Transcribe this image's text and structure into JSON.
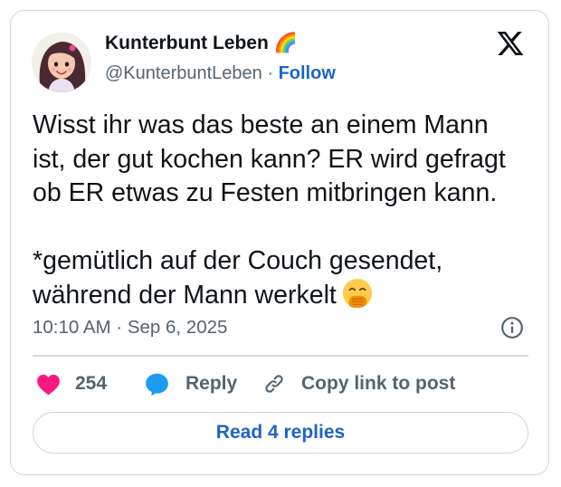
{
  "author": {
    "display_name": "Kunterbunt Leben 🌈",
    "handle": "@KunterbuntLeben",
    "separator": " · ",
    "follow_label": "Follow"
  },
  "tweet": {
    "paragraph_1": [
      "Wisst ihr was das beste an einem Mann",
      "ist, der gut kochen kann? ER wird gefragt",
      "ob ER etwas zu Festen mitbringen kann."
    ],
    "paragraph_2": [
      "*gemütlich auf der Couch gesendet,",
      "während der Mann werkelt"
    ],
    "emoji": "face-with-hand-over-mouth"
  },
  "timestamp": "10:10 AM · Sep 6, 2025",
  "actions": {
    "like_count": "254",
    "reply_label": "Reply",
    "copy_link_label": "Copy link to post"
  },
  "read_replies_label": "Read 4 replies",
  "colors": {
    "like": "#f91880",
    "reply": "#1d9bf0",
    "link": "#1d64c8",
    "muted": "#536471",
    "border": "#cfd9de"
  }
}
